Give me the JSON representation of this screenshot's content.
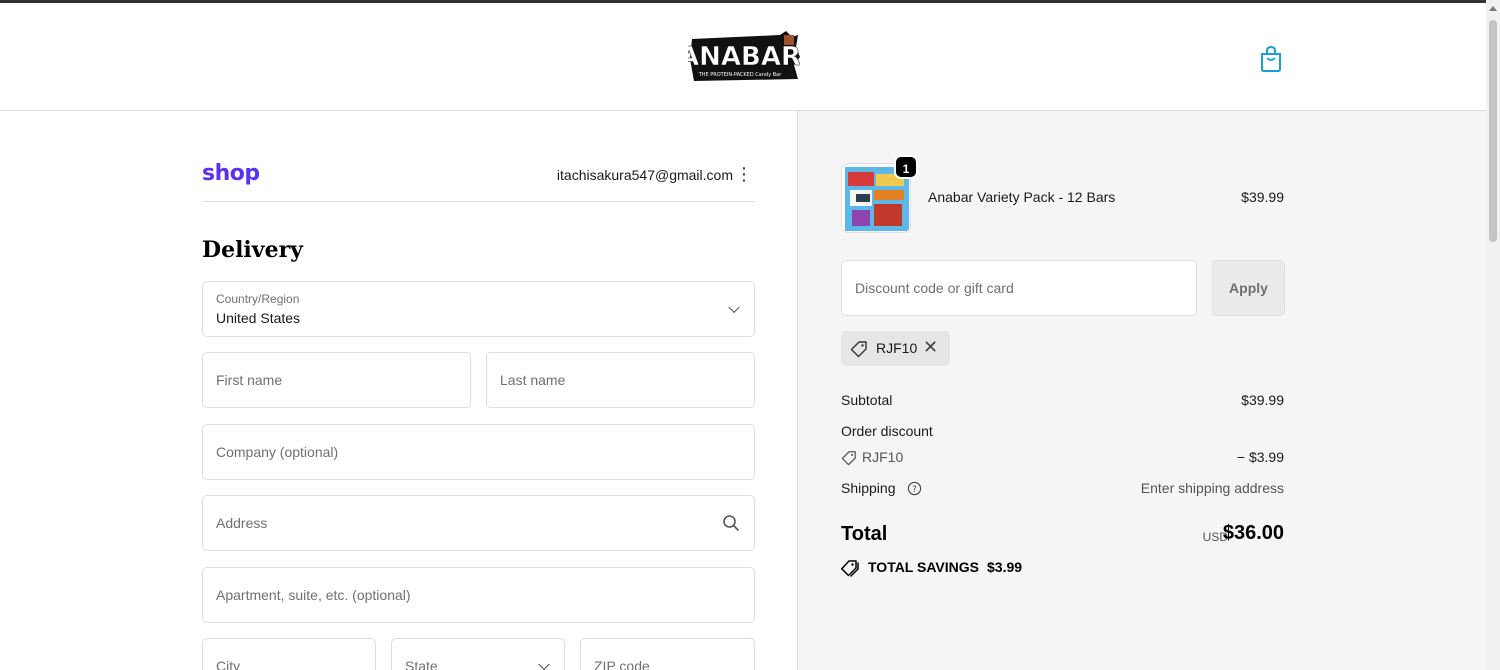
{
  "header": {
    "logo_text": "ANABAR",
    "logo_tagline": "THE PROTEIN-PACKED Candy Bar"
  },
  "account": {
    "shop_label": "shop",
    "email": "itachisakura547@gmail.com"
  },
  "delivery": {
    "title": "Delivery",
    "country_label": "Country/Region",
    "country_value": "United States",
    "first_name_placeholder": "First name",
    "last_name_placeholder": "Last name",
    "company_placeholder": "Company (optional)",
    "address_placeholder": "Address",
    "apartment_placeholder": "Apartment, suite, etc. (optional)",
    "city_placeholder": "City",
    "state_placeholder": "State",
    "zip_placeholder": "ZIP code"
  },
  "order": {
    "item": {
      "quantity": "1",
      "name": "Anabar Variety Pack - 12 Bars",
      "price": "$39.99"
    },
    "discount_placeholder": "Discount code or gift card",
    "apply_label": "Apply",
    "applied_code": "RJF10",
    "subtotal_label": "Subtotal",
    "subtotal_value": "$39.99",
    "order_discount_label": "Order discount",
    "discount_code": "RJF10",
    "discount_value": "− $3.99",
    "shipping_label": "Shipping",
    "shipping_value": "Enter shipping address",
    "total_label": "Total",
    "total_currency": "USD",
    "total_value": "$36.00",
    "savings_label": "TOTAL SAVINGS",
    "savings_value": "$3.99"
  },
  "colors": {
    "shop_brand": "#5a31f4",
    "cart_icon": "#1a9ed8",
    "summary_bg": "#f5f5f5"
  }
}
